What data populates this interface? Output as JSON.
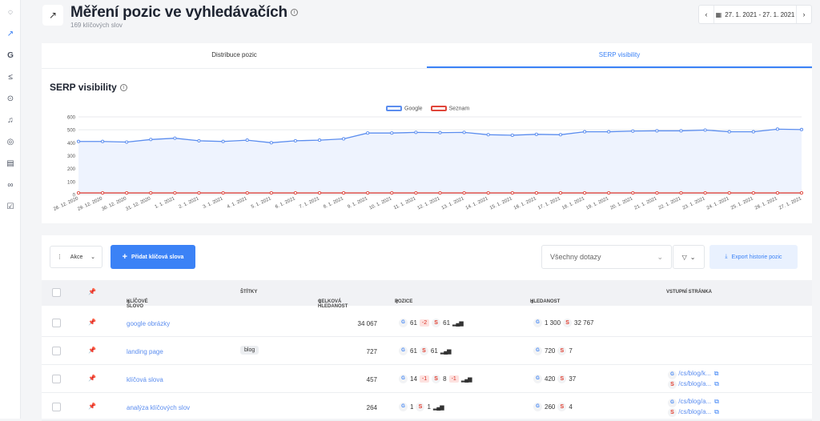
{
  "page": {
    "title": "Měření pozic ve vyhledávačích",
    "subtitle": "169 klíčových slov",
    "title_icon": "trending-up-icon"
  },
  "date_range": {
    "label": "27. 1. 2021 - 27. 1. 2021",
    "prev": "‹",
    "next": "›"
  },
  "tabs": [
    {
      "label": "Distribuce pozic",
      "active": false
    },
    {
      "label": "SERP visibility",
      "active": true
    }
  ],
  "chart_section": {
    "title": "SERP visibility"
  },
  "chart_data": {
    "type": "line",
    "title": "SERP visibility",
    "x": [
      "26. 12. 2020",
      "29. 12. 2020",
      "30. 12. 2020",
      "31. 12. 2020",
      "1. 1. 2021",
      "2. 1. 2021",
      "3. 1. 2021",
      "4. 1. 2021",
      "5. 1. 2021",
      "6. 1. 2021",
      "7. 1. 2021",
      "8. 1. 2021",
      "9. 1. 2021",
      "10. 1. 2021",
      "11. 1. 2021",
      "12. 1. 2021",
      "13. 1. 2021",
      "14. 1. 2021",
      "15. 1. 2021",
      "16. 1. 2021",
      "17. 1. 2021",
      "18. 1. 2021",
      "19. 1. 2021",
      "20. 1. 2021",
      "21. 1. 2021",
      "22. 1. 2021",
      "23. 1. 2021",
      "24. 1. 2021",
      "25. 1. 2021",
      "26. 1. 2021",
      "27. 1. 2021"
    ],
    "series": [
      {
        "name": "Google",
        "color": "#5b8def",
        "values": [
          410,
          410,
          405,
          425,
          435,
          415,
          410,
          420,
          400,
          415,
          420,
          430,
          475,
          475,
          480,
          478,
          480,
          462,
          458,
          465,
          462,
          485,
          485,
          490,
          492,
          492,
          498,
          485,
          485,
          505,
          502
        ]
      },
      {
        "name": "Seznam",
        "color": "#e0453a",
        "values": [
          12,
          12,
          12,
          12,
          12,
          12,
          12,
          12,
          12,
          12,
          12,
          12,
          12,
          12,
          12,
          12,
          12,
          12,
          12,
          12,
          12,
          12,
          12,
          12,
          12,
          12,
          12,
          12,
          12,
          12,
          12
        ]
      }
    ],
    "ylim": [
      0,
      600
    ],
    "yticks": [
      0,
      100,
      200,
      300,
      400,
      500,
      600
    ],
    "grid": true,
    "legend": "top-center"
  },
  "toolbar": {
    "actions_label": "Akce",
    "add_label": "Přidat klíčová slova",
    "query_select": "Všechny dotazy",
    "export_label": "Export historie pozic"
  },
  "table": {
    "headers": {
      "keyword": "KLÍČOVÉ SLOVO",
      "tags": "ŠTÍTKY",
      "volume": "CELKOVÁ HLEDANOST",
      "position": "POZICE",
      "searches": "HLEDANOST",
      "landing": "VSTUPNÍ STRÁNKA"
    },
    "rows": [
      {
        "keyword": "google obrázky",
        "tag": "",
        "volume": "34 067",
        "g_pos": "61",
        "g_chg": "-2",
        "s_pos": "61",
        "s_chg": "",
        "g_vol": "1 300",
        "s_vol": "32 767",
        "lp": []
      },
      {
        "keyword": "landing page",
        "tag": "blog",
        "volume": "727",
        "g_pos": "61",
        "g_chg": "",
        "s_pos": "61",
        "s_chg": "",
        "g_vol": "720",
        "s_vol": "7",
        "lp": []
      },
      {
        "keyword": "klíčová slova",
        "tag": "",
        "volume": "457",
        "g_pos": "14",
        "g_chg": "-1",
        "s_pos": "8",
        "s_chg": "-1",
        "g_vol": "420",
        "s_vol": "37",
        "lp": [
          "/cs/blog/k...",
          "/cs/blog/a..."
        ]
      },
      {
        "keyword": "analýza klíčových slov",
        "tag": "",
        "volume": "264",
        "g_pos": "1",
        "g_chg": "",
        "s_pos": "1",
        "s_chg": "",
        "g_vol": "260",
        "s_vol": "4",
        "lp": [
          "/cs/blog/a...",
          "/cs/blog/a..."
        ]
      }
    ]
  }
}
